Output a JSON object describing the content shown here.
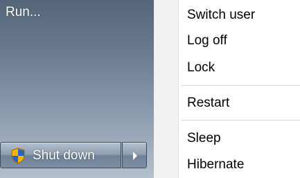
{
  "left_pane": {
    "run_label": "Run...",
    "shutdown_label": "Shut down"
  },
  "menu": {
    "items": [
      {
        "label": "Switch user"
      },
      {
        "label": "Log off"
      },
      {
        "label": "Lock"
      },
      {
        "label": "Restart"
      },
      {
        "label": "Sleep"
      },
      {
        "label": "Hibernate"
      }
    ]
  },
  "icons": {
    "shield": "shield-icon",
    "arrow": "chevron-right-icon"
  },
  "colors": {
    "pane_top": "#56667a",
    "pane_bottom": "#b3c0cd",
    "shield_gold": "#f5b400",
    "shield_blue": "#2a62c9",
    "menu_gutter": "#f1f1f1"
  }
}
